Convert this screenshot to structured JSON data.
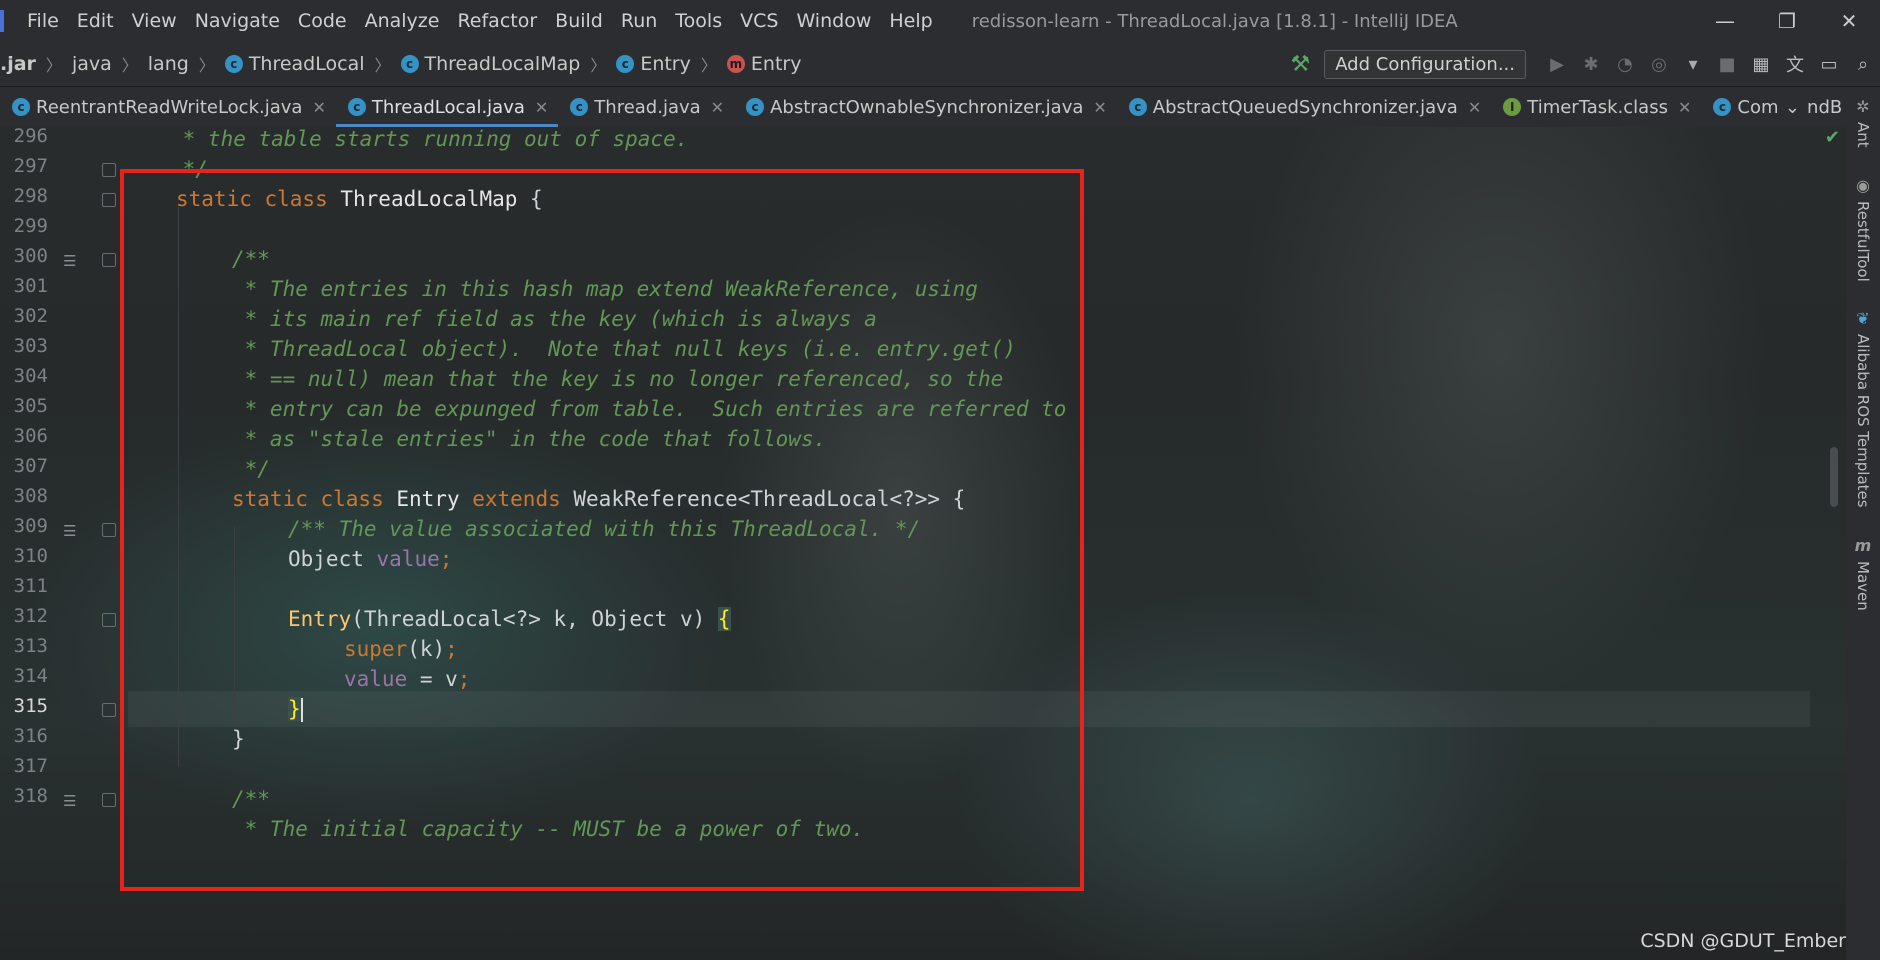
{
  "menubar": {
    "items": [
      {
        "label": "File"
      },
      {
        "label": "Edit"
      },
      {
        "label": "View"
      },
      {
        "label": "Navigate"
      },
      {
        "label": "Code"
      },
      {
        "label": "Analyze"
      },
      {
        "label": "Refactor"
      },
      {
        "label": "Build"
      },
      {
        "label": "Run"
      },
      {
        "label": "Tools"
      },
      {
        "label": "VCS"
      },
      {
        "label": "Window"
      },
      {
        "label": "Help"
      }
    ],
    "title": "redisson-learn - ThreadLocal.java [1.8.1] - IntelliJ IDEA"
  },
  "navbar": {
    "crumbs": [
      {
        "label": ".jar"
      },
      {
        "label": "java"
      },
      {
        "label": "lang"
      },
      {
        "label": "ThreadLocal",
        "icon": "c"
      },
      {
        "label": "ThreadLocalMap",
        "icon": "c"
      },
      {
        "label": "Entry",
        "icon": "c"
      },
      {
        "label": "Entry",
        "icon": "m"
      }
    ],
    "add_configuration": "Add Configuration..."
  },
  "tabs": [
    {
      "label": "ReentrantReadWriteLock.java",
      "icon": "c",
      "active": false
    },
    {
      "label": "ThreadLocal.java",
      "icon": "c",
      "active": true
    },
    {
      "label": "Thread.java",
      "icon": "c",
      "active": false
    },
    {
      "label": "AbstractOwnableSynchronizer.java",
      "icon": "c",
      "active": false
    },
    {
      "label": "AbstractQueuedSynchronizer.java",
      "icon": "c",
      "active": false
    },
    {
      "label": "TimerTask.class",
      "icon": "I",
      "active": false
    },
    {
      "label": "CommandB",
      "icon": "c",
      "active": false
    }
  ],
  "editor": {
    "line_numbers": [
      "296",
      "297",
      "298",
      "299",
      "300",
      "301",
      "302",
      "303",
      "304",
      "305",
      "306",
      "307",
      "308",
      "309",
      "310",
      "311",
      "312",
      "313",
      "314",
      "315",
      "316",
      "317",
      "318"
    ],
    "current_line": "315",
    "code": {
      "l296": " * the table starts running out of space.",
      "l297": " */",
      "l298_kw": "static class ",
      "l298_name": "ThreadLocalMap",
      "l298_rest": " {",
      "l300": "/**",
      "l301": " * The entries in this hash map extend WeakReference, using",
      "l302": " * its main ref field as the key (which is always a",
      "l303": " * ThreadLocal object).  Note that null keys (i.e. entry.get()",
      "l304": " * == null) mean that the key is no longer referenced, so the",
      "l305": " * entry can be expunged from table.  Such entries are referred to",
      "l306": " * as \"stale entries\" in the code that follows.",
      "l307": " */",
      "l308_kw": "static class ",
      "l308_name": "Entry ",
      "l308_ext": "extends ",
      "l308_rest": "WeakReference<ThreadLocal<?>> {",
      "l309": "/** The value associated with this ThreadLocal. */",
      "l310_type": "Object ",
      "l310_field": "value",
      "l310_semi": ";",
      "l312_fn": "Entry",
      "l312_params": "(ThreadLocal<?> k, Object v) ",
      "l312_brace": "{",
      "l313_kw": "super",
      "l313_rest": "(k)",
      "l313_semi": ";",
      "l314_field": "value",
      "l314_rest": " = v",
      "l314_semi": ";",
      "l315": "}",
      "l316": "}",
      "l318": "/**",
      "l319": " * The initial capacity -- MUST be a power of two."
    }
  },
  "right_panel": {
    "items": [
      {
        "label": "Ant"
      },
      {
        "label": "RestfulTool"
      },
      {
        "label": "Alibaba ROS Templates"
      },
      {
        "label": "Maven"
      }
    ]
  },
  "watermark": "CSDN @GDUT_Ember",
  "colors": {
    "keyword": "#cc7832",
    "comment": "#629755",
    "field": "#9876aa",
    "function": "#ffc66d",
    "highlight_box": "#e8231c"
  }
}
